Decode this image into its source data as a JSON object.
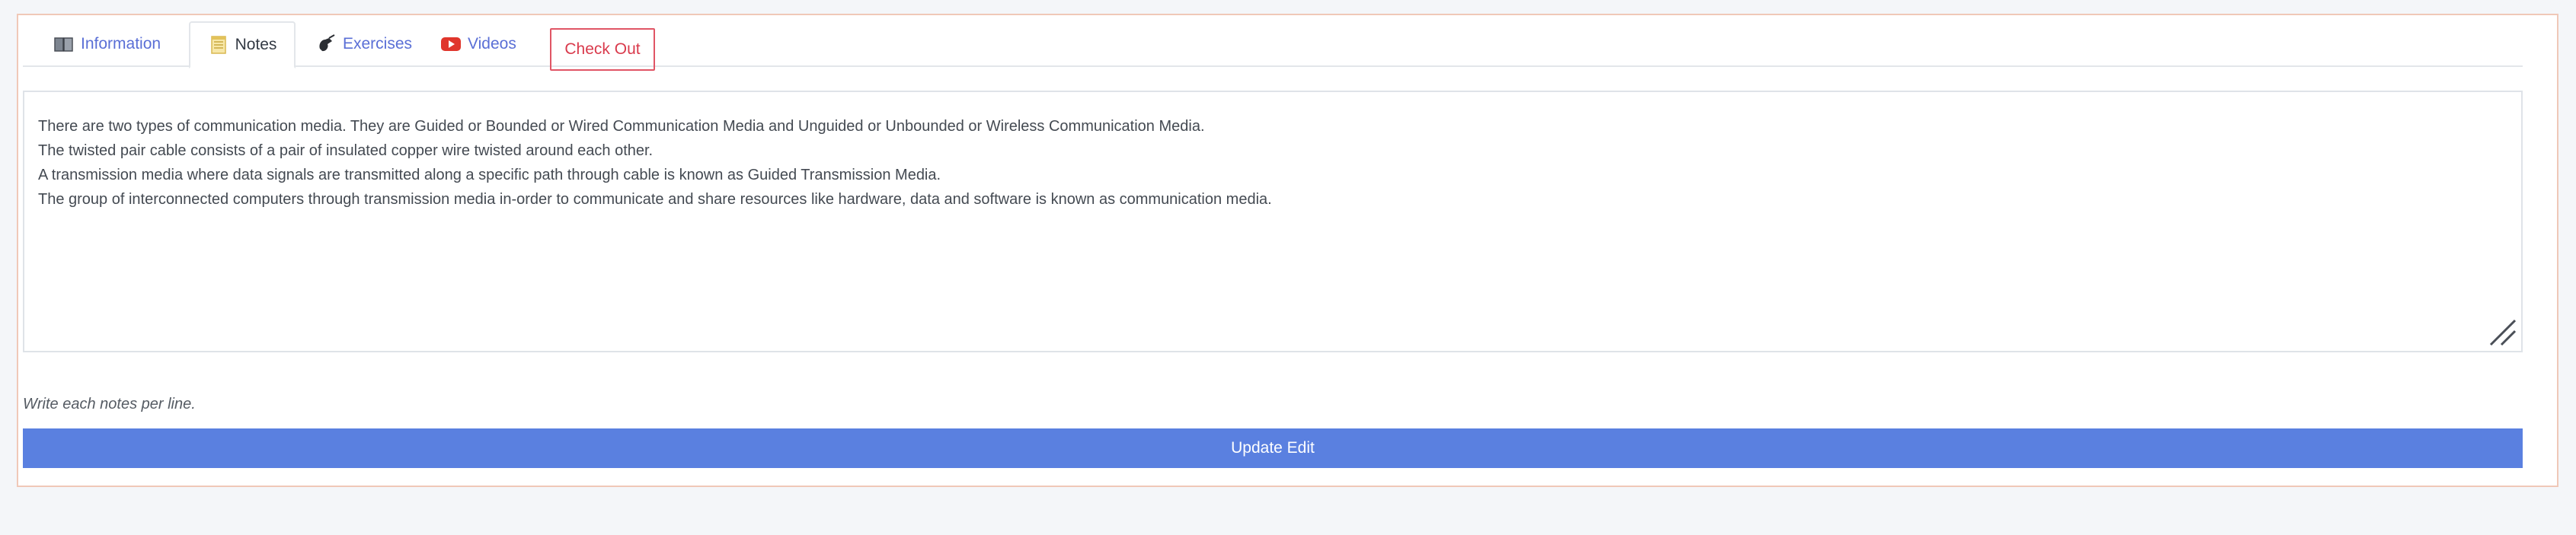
{
  "tabs": [
    {
      "label": "Information",
      "icon": "book-icon",
      "active": false
    },
    {
      "label": "Notes",
      "icon": "notepad-icon",
      "active": true
    },
    {
      "label": "Exercises",
      "icon": "hand-writing-icon",
      "active": false
    },
    {
      "label": "Videos",
      "icon": "play-button-icon",
      "active": false
    },
    {
      "label": "Check Out",
      "icon": "",
      "active": false
    }
  ],
  "notes": {
    "lines": [
      "There are two types of communication media. They are Guided or Bounded or Wired Communication Media and Unguided or Unbounded or Wireless Communication Media.",
      "The twisted pair cable consists of a pair of insulated copper wire twisted around each other.",
      "A transmission media where data signals are transmitted along a specific path through cable is known as Guided Transmission Media.",
      "The group of interconnected computers through transmission media in-order to communicate and share resources like hardware, data and software is known as communication media."
    ],
    "help_text": "Write each notes per line."
  },
  "actions": {
    "update_label": "Update Edit"
  },
  "colors": {
    "accent": "#5a80e0",
    "link": "#5a6fd6",
    "checkout": "#d93a4c"
  }
}
